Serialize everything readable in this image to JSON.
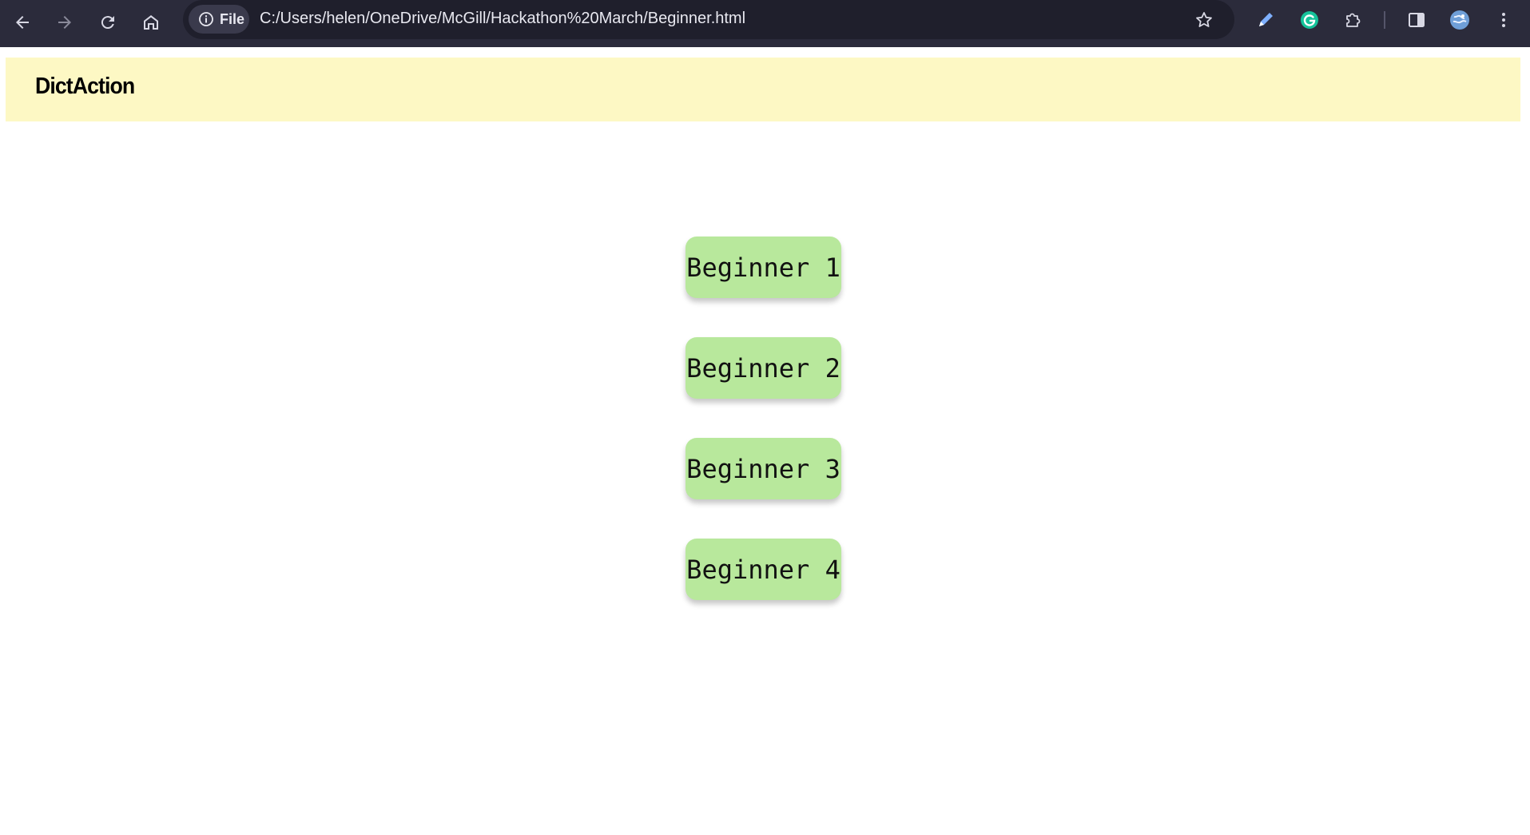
{
  "browser": {
    "address_chip_label": "File",
    "url": "C:/Users/helen/OneDrive/McGill/Hackathon%20March/Beginner.html",
    "toolbar_color": "#2b2b3b",
    "icons": [
      "back-arrow-icon",
      "forward-arrow-icon",
      "reload-icon",
      "home-icon",
      "info-icon",
      "star-icon",
      "pen-icon",
      "grammarly-icon",
      "extensions-puzzle-icon",
      "side-panel-icon",
      "profile-avatar-icon",
      "more-menu-icon"
    ]
  },
  "site": {
    "logo": "DictAction",
    "header_color": "#fdf8c4"
  },
  "levels": {
    "button_color": "#b8e89c",
    "items": [
      {
        "label": "Beginner 1"
      },
      {
        "label": "Beginner 2"
      },
      {
        "label": "Beginner 3"
      },
      {
        "label": "Beginner 4"
      }
    ]
  }
}
